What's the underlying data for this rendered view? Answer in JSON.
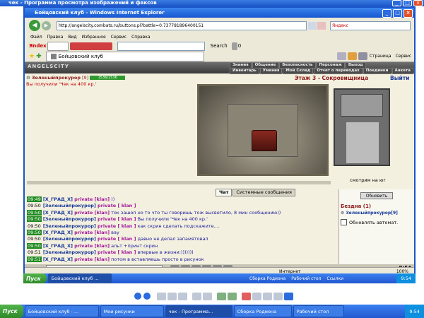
{
  "viewer": {
    "title": "чек - Программа просмотра изображений и факсов"
  },
  "ie": {
    "title": "Бойцовский клуб - Windows Internet Explorer",
    "address": "http://angelscity.combats.ru/buttons.pl?battle=0.737781896400151",
    "search_placeholder": "Яндекс",
    "menu": [
      "Файл",
      "Правка",
      "Вид",
      "Избранное",
      "Сервис",
      "Справка"
    ],
    "toolbar_search": "Search",
    "toolbar_count": "0",
    "tab": "Бойцовский клуб",
    "page_menu": "Страница",
    "service_menu": "Сервис",
    "status_internet": "Интернет",
    "zoom": "100%"
  },
  "game": {
    "logo": "ANGELSCITY",
    "nav_top": [
      "Знания",
      "Общение",
      "Безопасность",
      "Персонаж",
      "Выход"
    ],
    "nav_bottom": [
      "Инвентарь",
      "Умения",
      "Мой Склад",
      "Отчет о переводах",
      "Поединки",
      "Анкета"
    ],
    "player": "Зеленыйпрокурор",
    "player_level": "[9]",
    "hp": "1536/1536",
    "message": "Вы получили 'Чек на 400 кр.'",
    "floor_title": "Этаж 3 - Сокровищница",
    "exit": "Выйти",
    "look_dir": "смотрим на юг"
  },
  "chat": {
    "tabs": [
      "Чат",
      "Системные сообщения"
    ],
    "lines": [
      {
        "time": "09:49",
        "nick": "[X_ГРАД_X]",
        "priv": "private [klan]",
        "text": "))",
        "green": true
      },
      {
        "time": "09:50",
        "nick": "[Зеленыйпрокурор]",
        "priv": "private [ klan ]",
        "text": "",
        "green": false
      },
      {
        "time": "09:50",
        "nick": "[X_ГРАД_X]",
        "priv": "private [klan]",
        "text": "ток зашол но то что ты говоришь тож высветило, 8 мин сообщению))",
        "green": true
      },
      {
        "time": "09:50",
        "nick": "[Зеленыйпрокурор]",
        "priv": "private [ klan ]",
        "text": "Вы получили 'Чек на 400 кр.'",
        "green": true
      },
      {
        "time": "09:50",
        "nick": "[Зеленыйпрокурор]",
        "priv": "private [ klan ]",
        "text": "как скрин сделать подскажите....",
        "green": false
      },
      {
        "time": "09:50",
        "nick": "[X_ГРАД_X]",
        "priv": "private [klan]",
        "text": "вау",
        "green": true
      },
      {
        "time": "09:50",
        "nick": "[Зеленыйпрокурор]",
        "priv": "private [ klan ]",
        "text": "давно не делал запамятовал",
        "green": false
      },
      {
        "time": "09:50",
        "nick": "[X_ГРАД_X]",
        "priv": "private [klan]",
        "text": "альт +принт скрин",
        "green": true
      },
      {
        "time": "09:51",
        "nick": "[Зеленыйпрокурор]",
        "priv": "private [ klan ]",
        "text": "впервые в жизни:)))))))",
        "green": false
      },
      {
        "time": "09:51",
        "nick": "[X_ГРАД_X]",
        "priv": "private [klan]",
        "text": "потом в вставляешь просто в рисунок",
        "green": true
      }
    ]
  },
  "right_panel": {
    "refresh": "Обновить",
    "abyss": "Бездна (1)",
    "abyss_player": "Зеленыйпрокурор[9]",
    "auto_refresh": "Обновлять автомат."
  },
  "inner_taskbar": {
    "start": "Пуск",
    "items": [
      "Бойцовский клуб ..."
    ],
    "right_items": [
      "Сборка Родиона",
      "Рабочий стол",
      "Ссылки"
    ],
    "clock": "9:54"
  },
  "outer_taskbar": {
    "start": "Пуск",
    "items": [
      "Бойцовский клуб - ...",
      "Мои рисунки",
      "чек - Программа...",
      "Сборка Родиона",
      "Рабочий стол"
    ],
    "clock": "9:54"
  },
  "colors": {
    "xp_blue": "#2258d0",
    "game_dark": "#3a3a3a",
    "chat_time_bg": "#1f8a1f",
    "private_magenta": "#a21a9a"
  }
}
